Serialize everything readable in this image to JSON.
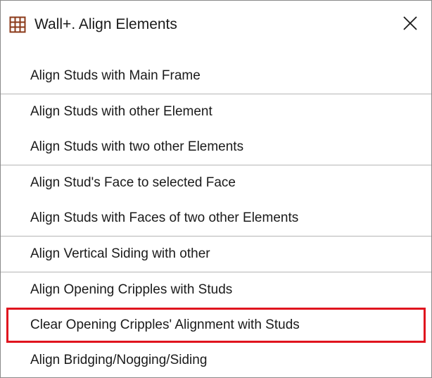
{
  "window": {
    "title": "Wall+. Align Elements",
    "app_icon": "wall-grid-icon",
    "close_icon": "close-icon"
  },
  "menu": {
    "items": [
      {
        "label": "Align Studs with Main Frame"
      },
      {
        "label": "Align Studs with other Element"
      },
      {
        "label": "Align Studs with two other Elements"
      },
      {
        "label": "Align Stud's Face to selected Face"
      },
      {
        "label": "Align Studs with Faces of two other Elements"
      },
      {
        "label": "Align Vertical Siding with other"
      },
      {
        "label": "Align Opening Cripples with Studs"
      },
      {
        "label": "Clear Opening Cripples' Alignment with Studs"
      },
      {
        "label": "Align Bridging/Nogging/Siding"
      }
    ]
  },
  "colors": {
    "highlight_border": "#e0141e",
    "separator": "#b5b5b5",
    "icon_brown": "#8b3a1a"
  }
}
